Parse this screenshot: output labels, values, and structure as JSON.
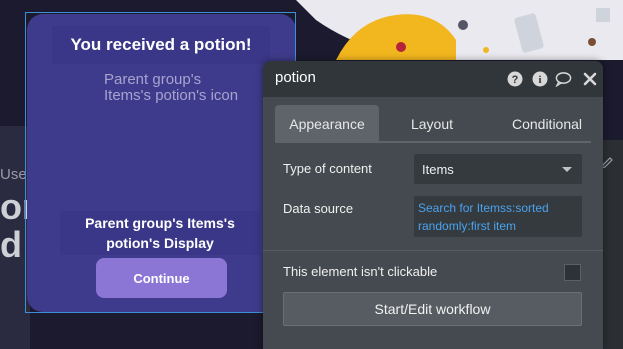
{
  "canvas": {
    "left_small_text": "Use",
    "left_big_text_1": "on",
    "left_big_text_2": "d"
  },
  "popup": {
    "title": "You received a potion!",
    "icon_placeholder": "Parent group's Items's potion's icon",
    "display_text": "Parent group's Items's potion's Display",
    "button_label": "Continue"
  },
  "editor": {
    "title": "potion",
    "header_icons": [
      "help-icon",
      "info-icon",
      "comment-icon",
      "close-icon"
    ],
    "tabs": [
      {
        "label": "Appearance",
        "active": true
      },
      {
        "label": "Layout",
        "active": false
      },
      {
        "label": "Conditional",
        "active": false
      }
    ],
    "type_of_content_label": "Type of content",
    "type_of_content_value": "Items",
    "data_source_label": "Data source",
    "data_source_value": "Search for Itemss:sorted randomly:first item",
    "not_clickable_label": "This element isn't clickable",
    "not_clickable_checked": false,
    "workflow_button_label": "Start/Edit workflow"
  },
  "colors": {
    "popup_bg": "#3f3b8c",
    "button_bg": "#8b76d6",
    "editor_bg": "#444a4f",
    "link_blue": "#4aa3ef"
  }
}
